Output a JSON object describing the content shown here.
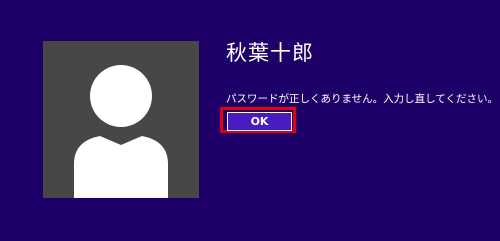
{
  "user": {
    "name": "秋葉十郎",
    "avatar_icon": "user-silhouette-icon"
  },
  "dialog": {
    "message": "パスワードが正しくありません。入力し直してください。",
    "ok_label": "OK"
  },
  "colors": {
    "background": "#1f0068",
    "avatar_tile": "#474747",
    "button_fill": "#4b1bc2",
    "highlight_border": "#e4000f",
    "text": "#ffffff"
  }
}
